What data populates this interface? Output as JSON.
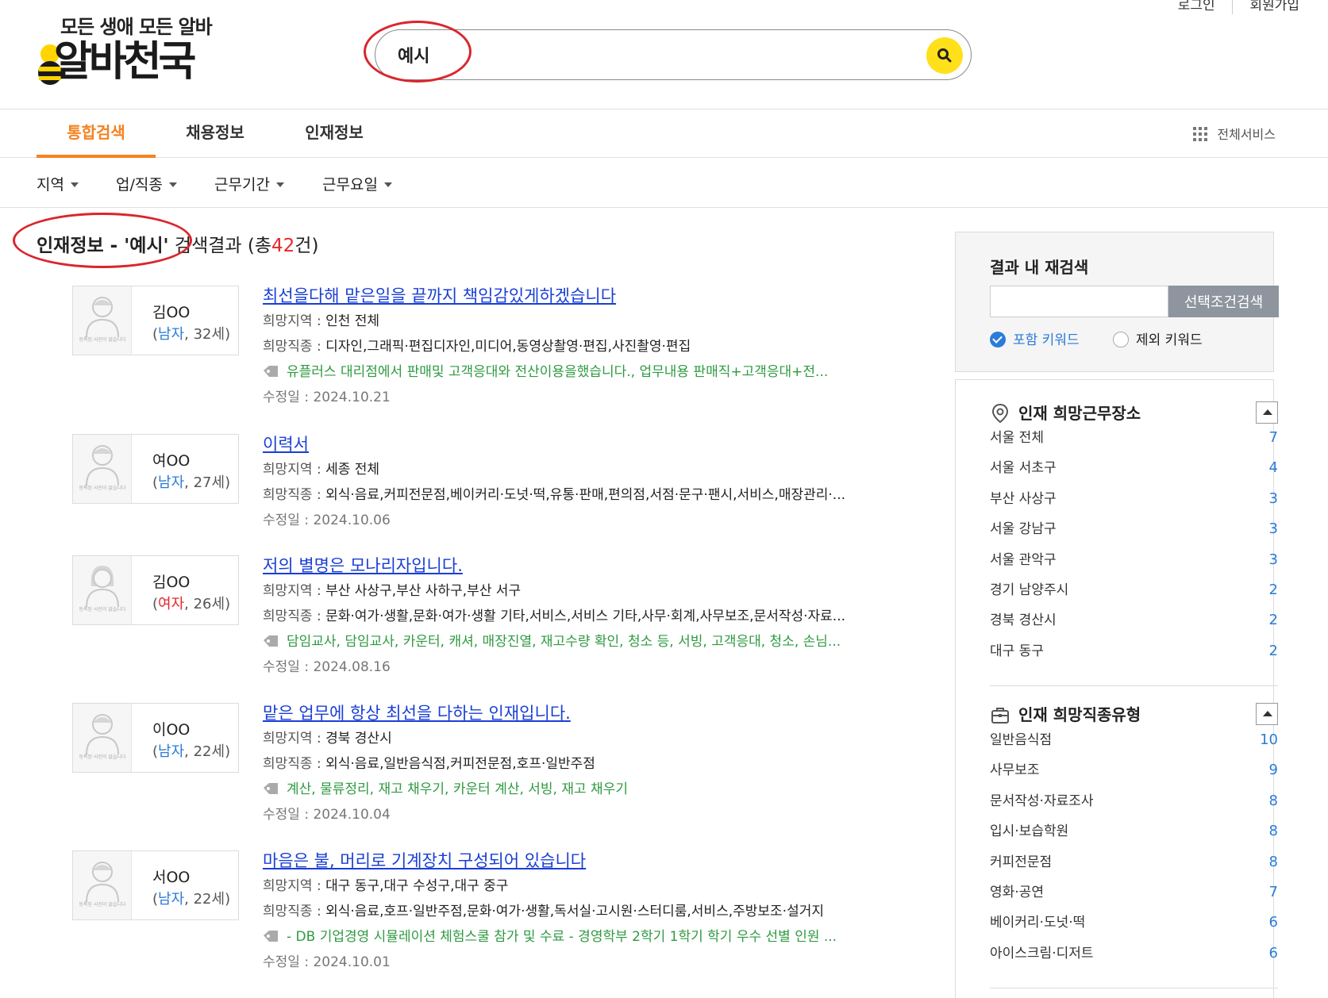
{
  "header": {
    "slogan": "모든 생애 모든 알바",
    "brand": "알바천국",
    "login": "로그인",
    "signup": "회원가입",
    "search_value": "예시"
  },
  "tabs": [
    {
      "label": "통합검색",
      "active": true
    },
    {
      "label": "채용정보",
      "active": false
    },
    {
      "label": "인재정보",
      "active": false
    }
  ],
  "all_services": "전체서비스",
  "filters": [
    "지역",
    "업/직종",
    "근무기간",
    "근무요일"
  ],
  "result_heading": {
    "prefix": "인재정보 - '예시'",
    "middle": " 검색결과 (총",
    "count": "42",
    "suffix": "건)"
  },
  "no_photo_text": "등록된 사진이 없습니다",
  "labels": {
    "region": "희망지역 : ",
    "job": "희망직종 : ",
    "modified": "수정일 : "
  },
  "results": [
    {
      "name": "김OO",
      "gender": "남자",
      "age": ", 32세)",
      "title": "최선을다해 맡은일을 끝까지 책임감있게하겠습니다",
      "region": "인천 전체",
      "job": "디자인,그래픽·편집디자인,미디어,동영상촬영·편집,사진촬영·편집",
      "tags": "유플러스 대리점에서 판매및 고객응대와 전산이용을했습니다., 업무내용 판매직+고객응대+전...",
      "modified": "2024.10.21"
    },
    {
      "name": "여OO",
      "gender": "남자",
      "age": ", 27세)",
      "title": "이력서",
      "region": "세종 전체",
      "job": "외식·음료,커피전문점,베이커리·도넛·떡,유통·판매,편의점,서점·문구·팬시,서비스,매장관리·...",
      "tags": "",
      "modified": "2024.10.06"
    },
    {
      "name": "김OO",
      "gender": "여자",
      "age": ", 26세)",
      "title": "저의 별명은 모나리자입니다.",
      "region": "부산 사상구,부산 사하구,부산 서구",
      "job": "문화·여가·생활,문화·여가·생활 기타,서비스,서비스 기타,사무·회계,사무보조,문서작성·자료...",
      "tags": "담임교사, 담임교사, 카운터, 캐셔, 매장진열, 재고수량 확인, 청소 등, 서빙, 고객응대, 청소, 손님...",
      "modified": "2024.08.16"
    },
    {
      "name": "이OO",
      "gender": "남자",
      "age": ", 22세)",
      "title": "맡은 업무에 항상 최선을 다하는 인재입니다.",
      "region": "경북 경산시",
      "job": "외식·음료,일반음식점,커피전문점,호프·일반주점",
      "tags": "계산, 물류정리, 재고 채우기, 카운터 계산, 서빙, 재고 채우기",
      "modified": "2024.10.04"
    },
    {
      "name": "서OO",
      "gender": "남자",
      "age": ", 22세)",
      "title": "마음은 불, 머리로 기계장치 구성되어 있습니다",
      "region": "대구 동구,대구 수성구,대구 중구",
      "job": "외식·음료,호프·일반주점,문화·여가·생활,독서실·고시원·스터디룸,서비스,주방보조·설거지",
      "tags": "- DB 기업경영 시뮬레이션 체험스쿨 참가 및 수료 - 경영학부 2학기 1학기 학기 우수 선별 인원 ...",
      "modified": "2024.10.01"
    }
  ],
  "refine": {
    "title": "결과 내 재검색",
    "input_value": "",
    "button": "선택조건검색",
    "include": "포함 키워드",
    "exclude": "제외 키워드"
  },
  "facet_region": {
    "title": "인재 희망근무장소",
    "items": [
      {
        "label": "서울 전체",
        "count": "7"
      },
      {
        "label": "서울 서초구",
        "count": "4"
      },
      {
        "label": "부산 사상구",
        "count": "3"
      },
      {
        "label": "서울 강남구",
        "count": "3"
      },
      {
        "label": "서울 관악구",
        "count": "3"
      },
      {
        "label": "경기 남양주시",
        "count": "2"
      },
      {
        "label": "경북 경산시",
        "count": "2"
      },
      {
        "label": "대구 동구",
        "count": "2"
      }
    ]
  },
  "facet_job": {
    "title": "인재 희망직종유형",
    "items": [
      {
        "label": "일반음식점",
        "count": "10"
      },
      {
        "label": "사무보조",
        "count": "9"
      },
      {
        "label": "문서작성·자료조사",
        "count": "8"
      },
      {
        "label": "입시·보습학원",
        "count": "8"
      },
      {
        "label": "커피전문점",
        "count": "8"
      },
      {
        "label": "영화·공연",
        "count": "7"
      },
      {
        "label": "베이커리·도넛·떡",
        "count": "6"
      },
      {
        "label": "아이스크림·디저트",
        "count": "6"
      }
    ]
  },
  "colors": {
    "accent": "#f58220",
    "link": "#1a3fd4",
    "tag": "#2f9a40",
    "male": "#2a7cd8",
    "female": "#e8262a",
    "search_button": "#ffe01b",
    "annotation": "#d9262c"
  }
}
